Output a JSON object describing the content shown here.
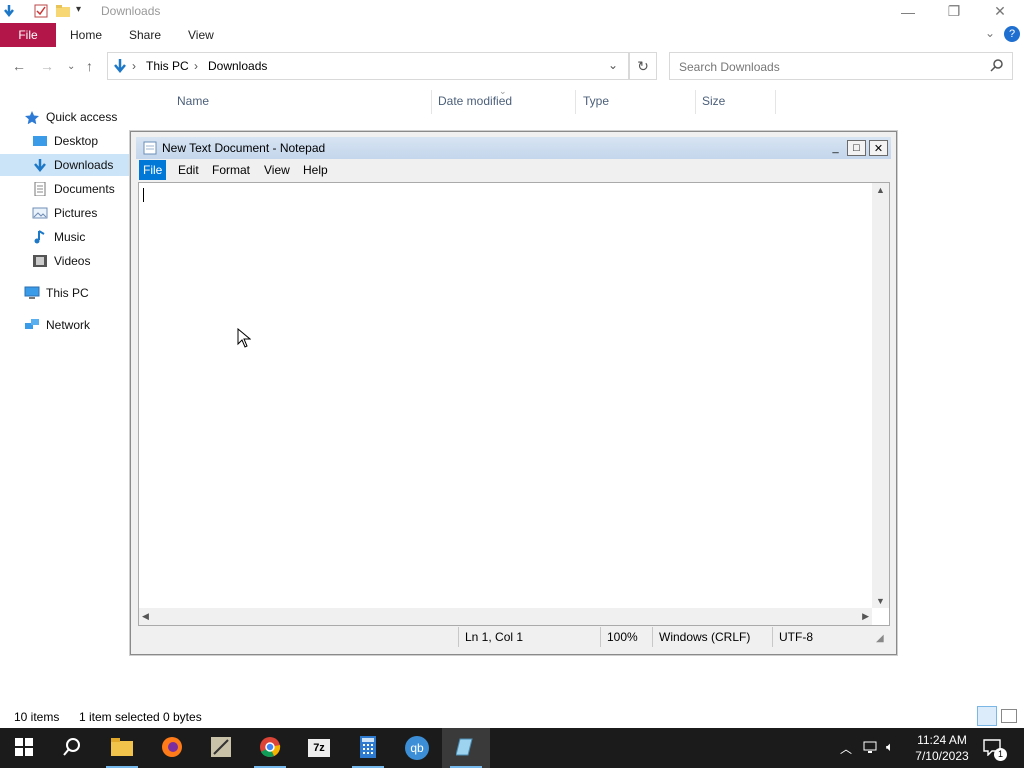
{
  "explorer": {
    "title": "Downloads",
    "ribbon_tabs": [
      "File",
      "Home",
      "Share",
      "View"
    ],
    "breadcrumb": [
      "This PC",
      "Downloads"
    ],
    "search_placeholder": "Search Downloads",
    "sidebar": [
      {
        "label": "Quick access",
        "icon": "star-icon"
      },
      {
        "label": "Desktop",
        "icon": "desktop-icon"
      },
      {
        "label": "Downloads",
        "icon": "download-icon"
      },
      {
        "label": "Documents",
        "icon": "documents-icon"
      },
      {
        "label": "Pictures",
        "icon": "pictures-icon"
      },
      {
        "label": "Music",
        "icon": "music-icon"
      },
      {
        "label": "Videos",
        "icon": "videos-icon"
      },
      {
        "label": "This PC",
        "icon": "computer-icon"
      },
      {
        "label": "Network",
        "icon": "network-icon"
      }
    ],
    "columns": [
      "Name",
      "Date modified",
      "Type",
      "Size"
    ],
    "status": {
      "items": "10 items",
      "selected": "1 item selected",
      "size": "0 bytes"
    }
  },
  "notepad": {
    "title": "New Text Document - Notepad",
    "menu": [
      "File",
      "Edit",
      "Format",
      "View",
      "Help"
    ],
    "content": "",
    "status": {
      "position": "Ln 1, Col 1",
      "zoom": "100%",
      "line_ending": "Windows (CRLF)",
      "encoding": "UTF-8"
    }
  },
  "taskbar": {
    "apps": [
      "start-icon",
      "search-icon",
      "file-explorer-icon",
      "firefox-icon",
      "app-icon",
      "chrome-icon",
      "7zip-icon",
      "calculator-icon",
      "qbittorrent-icon",
      "notepad-icon"
    ],
    "clock_time": "11:24 AM",
    "clock_date": "7/10/2023",
    "notification_count": "1"
  },
  "colors": {
    "accent": "#0078d7",
    "file_tab": "#b3174a",
    "taskbar": "#1b1b1b",
    "selection": "#cce4f7"
  }
}
